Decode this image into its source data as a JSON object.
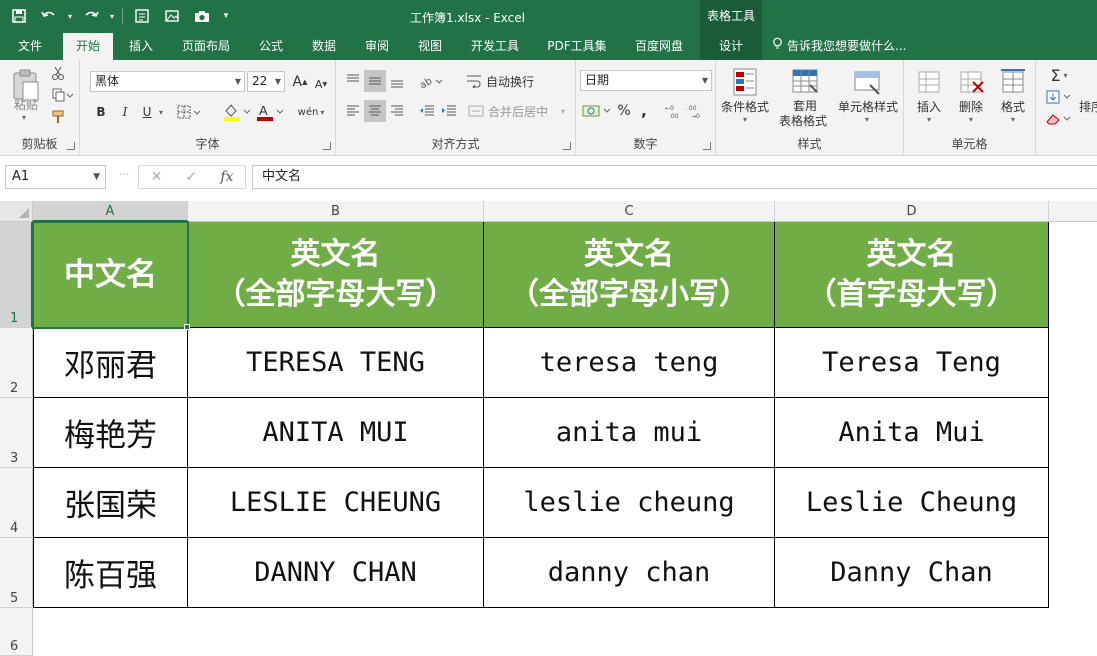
{
  "window": {
    "title": "工作簿1.xlsx - Excel",
    "context_tab_group": "表格工具"
  },
  "qat": {
    "save_icon": "save-icon",
    "undo_icon": "undo-icon",
    "redo_icon": "redo-icon",
    "qat_custom_icons": [
      "form-icon",
      "image-icon",
      "camera-icon"
    ]
  },
  "tabs": [
    {
      "label": "文件"
    },
    {
      "label": "开始",
      "active": true
    },
    {
      "label": "插入"
    },
    {
      "label": "页面布局"
    },
    {
      "label": "公式"
    },
    {
      "label": "数据"
    },
    {
      "label": "审阅"
    },
    {
      "label": "视图"
    },
    {
      "label": "开发工具"
    },
    {
      "label": "PDF工具集"
    },
    {
      "label": "百度网盘"
    },
    {
      "label": "设计"
    }
  ],
  "tellme": "告诉我您想要做什么...",
  "ribbon": {
    "clipboard": {
      "label": "剪贴板",
      "paste": "粘贴"
    },
    "font": {
      "label": "字体",
      "font_name": "黑体",
      "font_size": "22",
      "bold": "B",
      "italic": "I",
      "underline": "U",
      "phonetic": "wén"
    },
    "alignment": {
      "label": "对齐方式",
      "wrap": "自动换行",
      "merge": "合并后居中"
    },
    "number": {
      "label": "数字",
      "format": "日期",
      "percent": "%",
      "comma": ","
    },
    "styles": {
      "label": "样式",
      "conditional": "条件格式",
      "table_format_1": "套用",
      "table_format_2": "表格格式",
      "cell_styles": "单元格样式"
    },
    "cells": {
      "label": "单元格",
      "insert": "插入",
      "delete": "删除",
      "format": "格式"
    },
    "editing": {
      "sort": "排序"
    }
  },
  "formula_bar": {
    "name_box": "A1",
    "fx": "fx",
    "content": "中文名"
  },
  "grid": {
    "columns": [
      "A",
      "B",
      "C",
      "D"
    ],
    "rows": [
      "1",
      "2",
      "3",
      "4",
      "5",
      "6"
    ],
    "header": {
      "a": "中文名",
      "b1": "英文名",
      "b2": "（全部字母大写）",
      "c1": "英文名",
      "c2": "（全部字母小写）",
      "d1": "英文名",
      "d2": "（首字母大写）"
    },
    "data": [
      [
        "邓丽君",
        "TERESA TENG",
        "teresa teng",
        "Teresa Teng"
      ],
      [
        "梅艳芳",
        "ANITA MUI",
        "anita mui",
        "Anita Mui"
      ],
      [
        "张国荣",
        "LESLIE CHEUNG",
        "leslie cheung",
        "Leslie Cheung"
      ],
      [
        "陈百强",
        "DANNY CHAN",
        "danny chan",
        "Danny Chan"
      ]
    ]
  },
  "colors": {
    "excel_green": "#217346",
    "header_fill": "#70ad47"
  }
}
